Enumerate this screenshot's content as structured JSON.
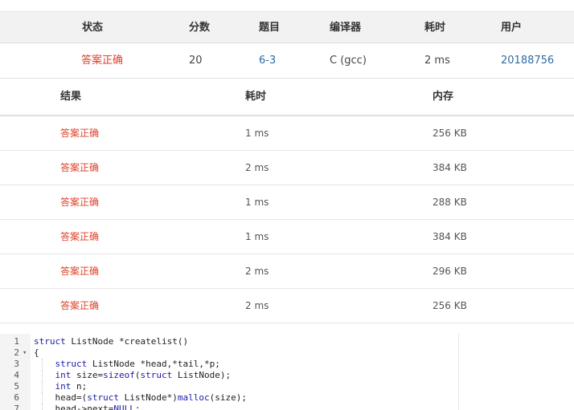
{
  "summary": {
    "headers": {
      "status": "状态",
      "score": "分数",
      "problem": "题目",
      "compiler": "编译器",
      "time": "耗时",
      "user": "用户"
    },
    "row": {
      "status": "答案正确",
      "score": "20",
      "problem": "6-3",
      "compiler": "C (gcc)",
      "time": "2 ms",
      "user": "20188756"
    }
  },
  "tests": {
    "headers": {
      "result": "结果",
      "time": "耗时",
      "memory": "内存"
    },
    "rows": [
      {
        "result": "答案正确",
        "time": "1 ms",
        "memory": "256 KB"
      },
      {
        "result": "答案正确",
        "time": "2 ms",
        "memory": "384 KB"
      },
      {
        "result": "答案正确",
        "time": "1 ms",
        "memory": "288 KB"
      },
      {
        "result": "答案正确",
        "time": "1 ms",
        "memory": "384 KB"
      },
      {
        "result": "答案正确",
        "time": "2 ms",
        "memory": "296 KB"
      },
      {
        "result": "答案正确",
        "time": "2 ms",
        "memory": "256 KB"
      }
    ]
  },
  "code": {
    "lines": [
      {
        "n": "1",
        "html": "<span class=\"kw\">struct</span> ListNode *createlist()"
      },
      {
        "n": "2",
        "fold": true,
        "html": "{"
      },
      {
        "n": "3",
        "guide": true,
        "html": "    <span class=\"kw\">struct</span> ListNode *head,*tail,*p;"
      },
      {
        "n": "4",
        "guide": true,
        "html": "    <span class=\"kw\">int</span> size=<span class=\"kw\">sizeof</span>(<span class=\"kw\">struct</span> ListNode);"
      },
      {
        "n": "5",
        "guide": true,
        "html": "    <span class=\"kw\">int</span> n;"
      },
      {
        "n": "6",
        "guide": true,
        "html": "    head=(<span class=\"kw\">struct</span> ListNode*)<span class=\"kw\">malloc</span>(size);"
      },
      {
        "n": "7",
        "guide": true,
        "html": "    head->next=<span class=\"kw\">NULL</span>;"
      }
    ]
  },
  "colors": {
    "accepted": "#e0412a",
    "link": "#2d6ca2",
    "keyword": "#1a1aa6"
  }
}
